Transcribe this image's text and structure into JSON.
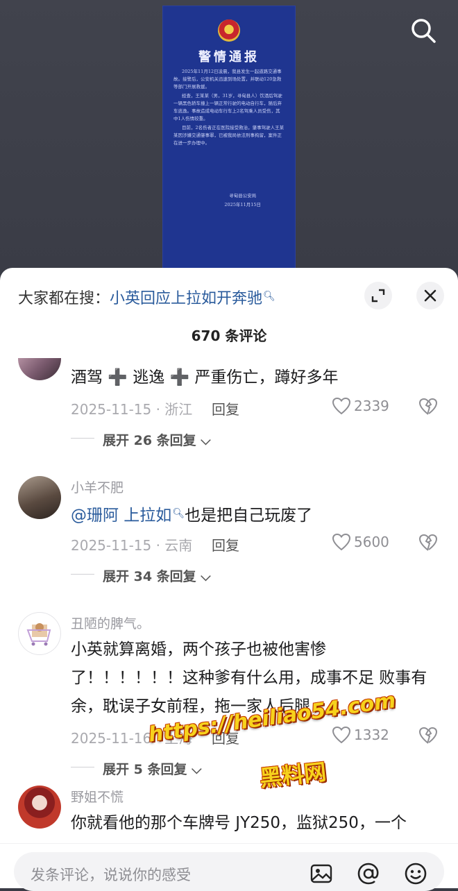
{
  "notice": {
    "title": "警情通报",
    "para1": "2025年11月12日凌晨，我县发生一起道路交通事故。接警后，公安机关迅速到场处置，并联动120急救等部门开展救援。",
    "para2": "经查，王某某（男，31岁，寻甸县人）饮酒后驾驶一辆黑色轿车撞上一辆正常行驶的电动自行车，随后弃车逃逸。事故造成电动车行车上2名驾乘人员受伤，其中1人伤情较重。",
    "para3": "目前，2名伤者正在医院接受救治，肇事驾驶人王某某因涉嫌交通肇事罪，已被我局依法刑事拘留，案件正在进一步办理中。",
    "signature": "寻甸县公安局",
    "date": "2025年11月15日"
  },
  "header": {
    "trend_prefix": "大家都在搜：",
    "trend_link": "小英回应上拉如开奔驰",
    "trend_icon": "search-icon",
    "comment_count": "670 条评论"
  },
  "comments": [
    {
      "username": "",
      "text": "酒驾 ➕ 逃逸 ➕ 严重伤亡，蹲好多年",
      "date_location": "2025-11-15 · 浙江",
      "reply_label": "回复",
      "likes": "2339",
      "expand_label": "展开 26 条回复"
    },
    {
      "username": "小羊不肥",
      "mention": "@珊阿 上拉如",
      "text": "也是把自己玩废了",
      "date_location": "2025-11-15 · 云南",
      "reply_label": "回复",
      "likes": "5600",
      "expand_label": "展开 34 条回复"
    },
    {
      "username": "丑陋的脾气。",
      "text_line1": "小英就算离婚，两个孩子也被他害惨",
      "text_line2": "了！！！！！！这种爹有什么用，成事不足 败事有",
      "text_line3": "余，耽误子女前程，拖一家人后腿",
      "date_location": "2025-11-16 · 上海",
      "reply_label": "回复",
      "likes": "1332",
      "expand_label": "展开 5 条回复"
    },
    {
      "username": "野姐不慌",
      "text": "你就看他的那个车牌号 JY250，监狱250，一个"
    }
  ],
  "watermark": {
    "url": "https://heiliao54.com",
    "name": "黑料网"
  },
  "input": {
    "placeholder": "发条评论，说说你的感受"
  },
  "colors": {
    "notice_bg": "#1f3590",
    "link": "#2a5b9c",
    "watermark": "#f7d21c"
  }
}
